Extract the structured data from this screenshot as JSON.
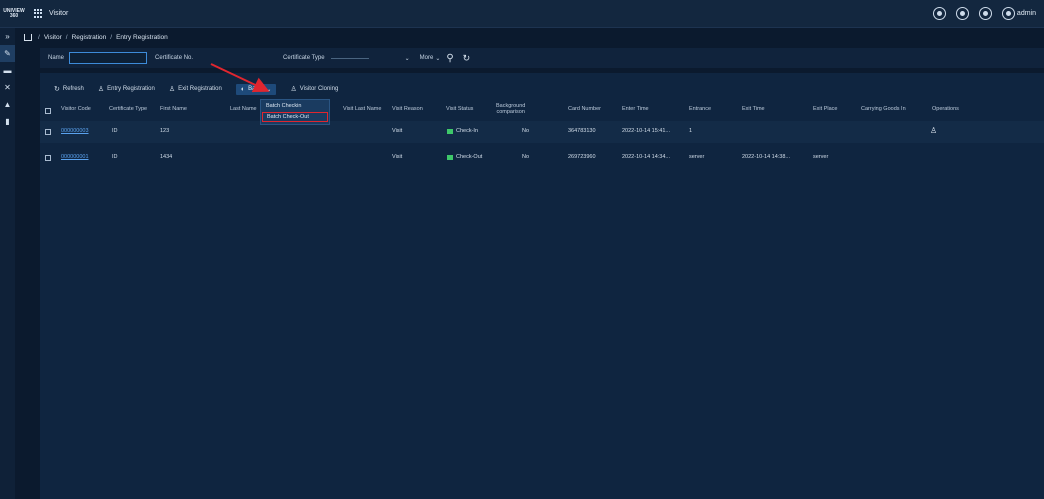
{
  "topbar": {
    "logo_text_1": "UNIVIEW",
    "logo_text_2": "360",
    "app_title": "Visitor",
    "user": "admin"
  },
  "sidebar": {
    "items": [
      {
        "icon": "expand-icon"
      },
      {
        "icon": "edit-icon"
      },
      {
        "icon": "camera-icon"
      },
      {
        "icon": "tools-icon"
      },
      {
        "icon": "person-icon"
      },
      {
        "icon": "document-icon"
      }
    ]
  },
  "breadcrumb": [
    "Visitor",
    "Registration",
    "Entry Registration"
  ],
  "filters": {
    "name_label": "Name",
    "name_value": "",
    "cert_no_label": "Certificate No.",
    "cert_type_label": "Certificate Type",
    "more_label": "More"
  },
  "toolbar": {
    "refresh": "Refresh",
    "entry_registration": "Entry Registration",
    "exit_registration": "Exit Registration",
    "batch": "Batch",
    "visitor_cloning": "Visitor Cloning"
  },
  "batch_menu": {
    "checkin": "Batch Checkin",
    "checkout": "Batch Check-Out"
  },
  "table": {
    "columns": {
      "visitor_code": "Visitor Code",
      "certificate_type": "Certificate Type",
      "first_name": "First Name",
      "last_name": "Last Name",
      "visit_last_name": "Visit Last Name",
      "visit_reason": "Visit Reason",
      "visit_status": "Visit Status",
      "background_line1": "Background",
      "background_line2": "comparison",
      "card_number": "Card Number",
      "enter_time": "Enter Time",
      "entrance": "Entrance",
      "exit_time": "Exit Time",
      "exit_place": "Exit Place",
      "carrying_goods": "Carrying Goods In",
      "operations": "Operations"
    },
    "rows": [
      {
        "visitor_code": "000000003",
        "certificate_type": "ID",
        "first_name": "123",
        "visit_reason": "Visit",
        "visit_status": "Check-In",
        "background": "No",
        "card_number": "364783130",
        "enter_time": "2022-10-14 15:41...",
        "entrance": "1",
        "exit_time": "",
        "exit_place": ""
      },
      {
        "visitor_code": "000000001",
        "certificate_type": "ID",
        "first_name": "1434",
        "visit_reason": "Visit",
        "visit_status": "Check-Out",
        "background": "No",
        "card_number": "269723960",
        "enter_time": "2022-10-14 14:34...",
        "entrance": "server",
        "exit_time": "2022-10-14 14:38...",
        "exit_place": "server"
      }
    ]
  },
  "colors": {
    "accent": "#3d8bd9",
    "highlight": "#e0262f",
    "status_green": "#3ec86a"
  }
}
